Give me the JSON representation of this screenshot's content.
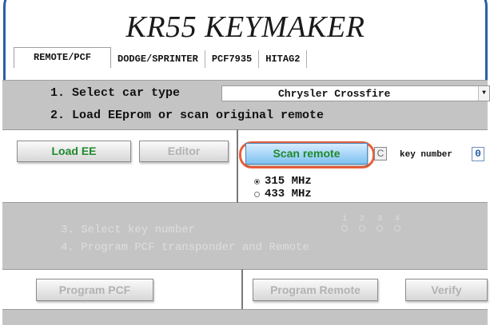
{
  "app": {
    "title": "KR55 KEYMAKER"
  },
  "tabs": [
    "REMOTE/PCF",
    "DODGE/SPRINTER",
    "PCF7935",
    "HITAG2"
  ],
  "steps": {
    "step1": "1. Select car type",
    "step2": "2. Load EEprom or scan original remote",
    "step3": "3. Select key number",
    "step4": "4. Program PCF transponder and Remote"
  },
  "car_type": {
    "selected": "Chrysler Crossfire"
  },
  "buttons": {
    "load_ee": "Load EE",
    "editor": "Editor",
    "scan_remote": "Scan remote",
    "program_pcf": "Program PCF",
    "program_remote": "Program Remote",
    "verify": "Verify"
  },
  "c_checkbox": "C",
  "key_number": {
    "label": "key number",
    "value": "0"
  },
  "frequency": {
    "options": [
      "315 MHz",
      "433 MHz"
    ],
    "selected": "315 MHz"
  },
  "key_options": [
    "1",
    "2",
    "3",
    "4"
  ],
  "colors": {
    "border": "#2a5fa5",
    "panel": "#c4c4c4",
    "green_text": "#1f8a2c",
    "highlight": "#e8603a",
    "scan_button": "#7fc2f1"
  },
  "icons": {
    "dropdown": "triangle-down-icon"
  }
}
